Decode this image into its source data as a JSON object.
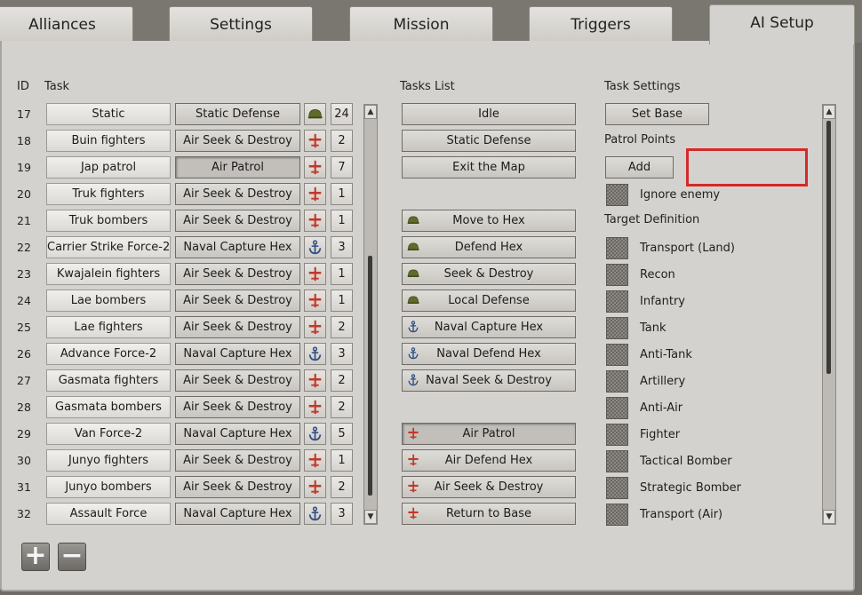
{
  "tabs": [
    {
      "label": "Alliances",
      "active": false
    },
    {
      "label": "Settings",
      "active": false
    },
    {
      "label": "Mission",
      "active": false
    },
    {
      "label": "Triggers",
      "active": false
    },
    {
      "label": "AI Setup",
      "active": true
    }
  ],
  "task_table": {
    "header_id": "ID",
    "header_task": "Task",
    "rows": [
      {
        "id": "17",
        "name": "Static",
        "task": "Static Defense",
        "icon": "helmet-icon",
        "count": "24"
      },
      {
        "id": "18",
        "name": "Buin fighters",
        "task": "Air Seek & Destroy",
        "icon": "plane-icon",
        "count": "2"
      },
      {
        "id": "19",
        "name": "Jap patrol",
        "task": "Air Patrol",
        "icon": "plane-icon",
        "count": "7",
        "selected": true
      },
      {
        "id": "20",
        "name": "Truk fighters",
        "task": "Air Seek & Destroy",
        "icon": "plane-icon",
        "count": "1"
      },
      {
        "id": "21",
        "name": "Truk bombers",
        "task": "Air Seek & Destroy",
        "icon": "plane-icon",
        "count": "1"
      },
      {
        "id": "22",
        "name": "Carrier Strike Force-2",
        "task": "Naval Capture Hex",
        "icon": "anchor-icon",
        "count": "3"
      },
      {
        "id": "23",
        "name": "Kwajalein fighters",
        "task": "Air Seek & Destroy",
        "icon": "plane-icon",
        "count": "1"
      },
      {
        "id": "24",
        "name": "Lae bombers",
        "task": "Air Seek & Destroy",
        "icon": "plane-icon",
        "count": "1"
      },
      {
        "id": "25",
        "name": "Lae fighters",
        "task": "Air Seek & Destroy",
        "icon": "plane-icon",
        "count": "2"
      },
      {
        "id": "26",
        "name": "Advance Force-2",
        "task": "Naval Capture Hex",
        "icon": "anchor-icon",
        "count": "3"
      },
      {
        "id": "27",
        "name": "Gasmata fighters",
        "task": "Air Seek & Destroy",
        "icon": "plane-icon",
        "count": "2"
      },
      {
        "id": "28",
        "name": "Gasmata bombers",
        "task": "Air Seek & Destroy",
        "icon": "plane-icon",
        "count": "2"
      },
      {
        "id": "29",
        "name": "Van Force-2",
        "task": "Naval Capture Hex",
        "icon": "anchor-icon",
        "count": "5"
      },
      {
        "id": "30",
        "name": "Junyo fighters",
        "task": "Air Seek & Destroy",
        "icon": "plane-icon",
        "count": "1"
      },
      {
        "id": "31",
        "name": "Junyo bombers",
        "task": "Air Seek & Destroy",
        "icon": "plane-icon",
        "count": "2"
      },
      {
        "id": "32",
        "name": "Assault Force",
        "task": "Naval Capture Hex",
        "icon": "anchor-icon",
        "count": "3"
      }
    ]
  },
  "tasks_list": {
    "header": "Tasks List",
    "general": [
      "Idle",
      "Static Defense",
      "Exit the Map"
    ],
    "land": [
      "Move to Hex",
      "Defend Hex",
      "Seek & Destroy",
      "Local Defense"
    ],
    "naval": [
      "Naval Capture Hex",
      "Naval Defend Hex",
      "Naval Seek & Destroy"
    ],
    "air": [
      "Air Patrol",
      "Air Defend Hex",
      "Air Seek & Destroy",
      "Return to Base"
    ],
    "selected": "Air Patrol"
  },
  "task_settings": {
    "header": "Task Settings",
    "set_base_label": "Set Base",
    "patrol_points_label": "Patrol Points",
    "add_label": "Add",
    "ignore_enemy_label": "Ignore enemy",
    "target_definition_label": "Target Definition",
    "targets": [
      "Transport (Land)",
      "Recon",
      "Infantry",
      "Tank",
      "Anti-Tank",
      "Artillery",
      "Anti-Air",
      "Fighter",
      "Tactical Bomber",
      "Strategic Bomber",
      "Transport (Air)"
    ]
  },
  "bottom_buttons": {
    "add": "+",
    "remove": "−"
  },
  "colors": {
    "panel_bg": "#d4d2ce",
    "highlight_box": "#d42a2a",
    "plane_icon": "#c0392b",
    "anchor_icon": "#2e4f86",
    "helmet_icon": "#5e6b2a"
  }
}
